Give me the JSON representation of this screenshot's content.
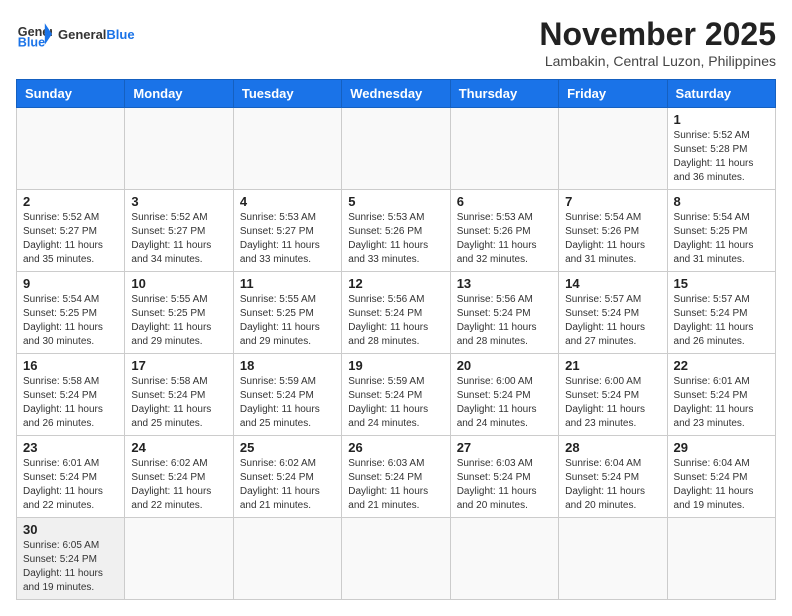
{
  "logo": {
    "text_general": "General",
    "text_blue": "Blue"
  },
  "title": "November 2025",
  "subtitle": "Lambakin, Central Luzon, Philippines",
  "weekdays": [
    "Sunday",
    "Monday",
    "Tuesday",
    "Wednesday",
    "Thursday",
    "Friday",
    "Saturday"
  ],
  "weeks": [
    [
      {
        "day": "",
        "info": ""
      },
      {
        "day": "",
        "info": ""
      },
      {
        "day": "",
        "info": ""
      },
      {
        "day": "",
        "info": ""
      },
      {
        "day": "",
        "info": ""
      },
      {
        "day": "",
        "info": ""
      },
      {
        "day": "1",
        "info": "Sunrise: 5:52 AM\nSunset: 5:28 PM\nDaylight: 11 hours and 36 minutes."
      }
    ],
    [
      {
        "day": "2",
        "info": "Sunrise: 5:52 AM\nSunset: 5:27 PM\nDaylight: 11 hours and 35 minutes."
      },
      {
        "day": "3",
        "info": "Sunrise: 5:52 AM\nSunset: 5:27 PM\nDaylight: 11 hours and 34 minutes."
      },
      {
        "day": "4",
        "info": "Sunrise: 5:53 AM\nSunset: 5:27 PM\nDaylight: 11 hours and 33 minutes."
      },
      {
        "day": "5",
        "info": "Sunrise: 5:53 AM\nSunset: 5:26 PM\nDaylight: 11 hours and 33 minutes."
      },
      {
        "day": "6",
        "info": "Sunrise: 5:53 AM\nSunset: 5:26 PM\nDaylight: 11 hours and 32 minutes."
      },
      {
        "day": "7",
        "info": "Sunrise: 5:54 AM\nSunset: 5:26 PM\nDaylight: 11 hours and 31 minutes."
      },
      {
        "day": "8",
        "info": "Sunrise: 5:54 AM\nSunset: 5:25 PM\nDaylight: 11 hours and 31 minutes."
      }
    ],
    [
      {
        "day": "9",
        "info": "Sunrise: 5:54 AM\nSunset: 5:25 PM\nDaylight: 11 hours and 30 minutes."
      },
      {
        "day": "10",
        "info": "Sunrise: 5:55 AM\nSunset: 5:25 PM\nDaylight: 11 hours and 29 minutes."
      },
      {
        "day": "11",
        "info": "Sunrise: 5:55 AM\nSunset: 5:25 PM\nDaylight: 11 hours and 29 minutes."
      },
      {
        "day": "12",
        "info": "Sunrise: 5:56 AM\nSunset: 5:24 PM\nDaylight: 11 hours and 28 minutes."
      },
      {
        "day": "13",
        "info": "Sunrise: 5:56 AM\nSunset: 5:24 PM\nDaylight: 11 hours and 28 minutes."
      },
      {
        "day": "14",
        "info": "Sunrise: 5:57 AM\nSunset: 5:24 PM\nDaylight: 11 hours and 27 minutes."
      },
      {
        "day": "15",
        "info": "Sunrise: 5:57 AM\nSunset: 5:24 PM\nDaylight: 11 hours and 26 minutes."
      }
    ],
    [
      {
        "day": "16",
        "info": "Sunrise: 5:58 AM\nSunset: 5:24 PM\nDaylight: 11 hours and 26 minutes."
      },
      {
        "day": "17",
        "info": "Sunrise: 5:58 AM\nSunset: 5:24 PM\nDaylight: 11 hours and 25 minutes."
      },
      {
        "day": "18",
        "info": "Sunrise: 5:59 AM\nSunset: 5:24 PM\nDaylight: 11 hours and 25 minutes."
      },
      {
        "day": "19",
        "info": "Sunrise: 5:59 AM\nSunset: 5:24 PM\nDaylight: 11 hours and 24 minutes."
      },
      {
        "day": "20",
        "info": "Sunrise: 6:00 AM\nSunset: 5:24 PM\nDaylight: 11 hours and 24 minutes."
      },
      {
        "day": "21",
        "info": "Sunrise: 6:00 AM\nSunset: 5:24 PM\nDaylight: 11 hours and 23 minutes."
      },
      {
        "day": "22",
        "info": "Sunrise: 6:01 AM\nSunset: 5:24 PM\nDaylight: 11 hours and 23 minutes."
      }
    ],
    [
      {
        "day": "23",
        "info": "Sunrise: 6:01 AM\nSunset: 5:24 PM\nDaylight: 11 hours and 22 minutes."
      },
      {
        "day": "24",
        "info": "Sunrise: 6:02 AM\nSunset: 5:24 PM\nDaylight: 11 hours and 22 minutes."
      },
      {
        "day": "25",
        "info": "Sunrise: 6:02 AM\nSunset: 5:24 PM\nDaylight: 11 hours and 21 minutes."
      },
      {
        "day": "26",
        "info": "Sunrise: 6:03 AM\nSunset: 5:24 PM\nDaylight: 11 hours and 21 minutes."
      },
      {
        "day": "27",
        "info": "Sunrise: 6:03 AM\nSunset: 5:24 PM\nDaylight: 11 hours and 20 minutes."
      },
      {
        "day": "28",
        "info": "Sunrise: 6:04 AM\nSunset: 5:24 PM\nDaylight: 11 hours and 20 minutes."
      },
      {
        "day": "29",
        "info": "Sunrise: 6:04 AM\nSunset: 5:24 PM\nDaylight: 11 hours and 19 minutes."
      }
    ],
    [
      {
        "day": "30",
        "info": "Sunrise: 6:05 AM\nSunset: 5:24 PM\nDaylight: 11 hours and 19 minutes."
      },
      {
        "day": "",
        "info": ""
      },
      {
        "day": "",
        "info": ""
      },
      {
        "day": "",
        "info": ""
      },
      {
        "day": "",
        "info": ""
      },
      {
        "day": "",
        "info": ""
      },
      {
        "day": "",
        "info": ""
      }
    ]
  ]
}
